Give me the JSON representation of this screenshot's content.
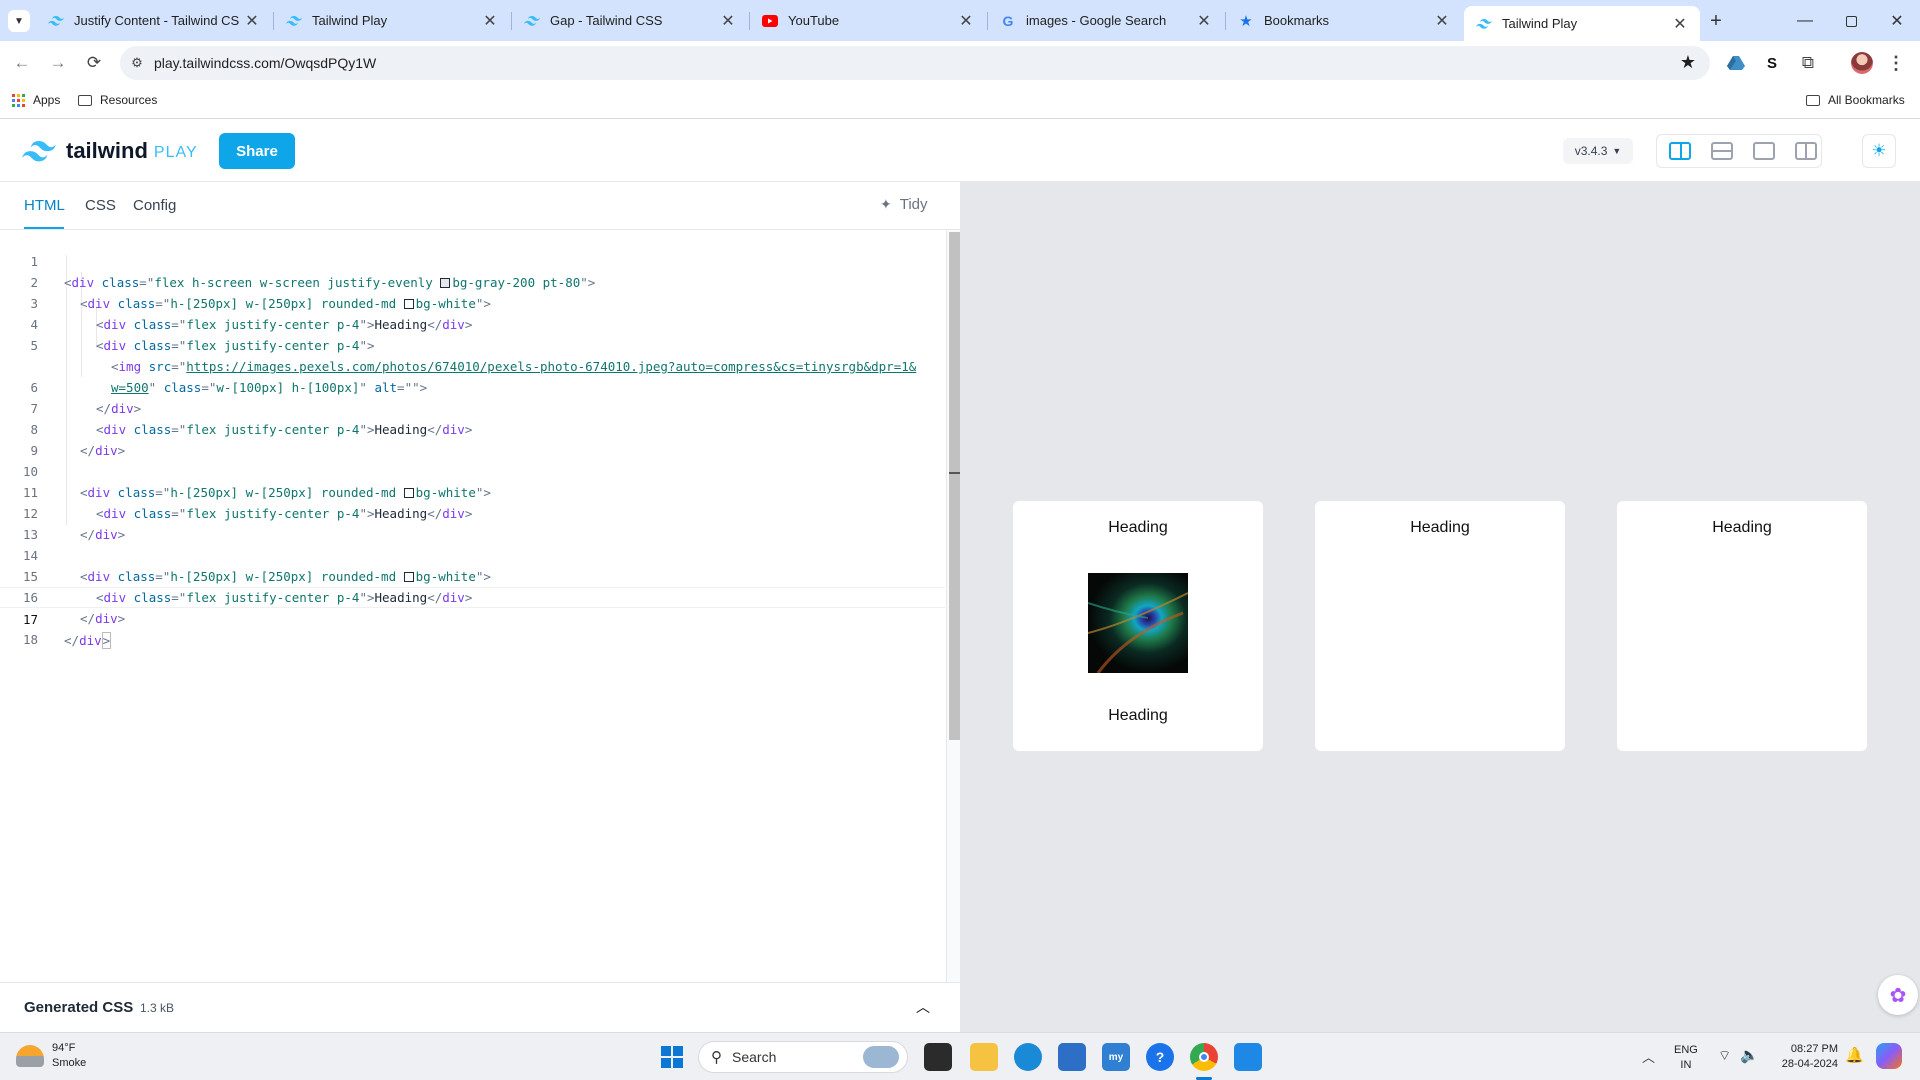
{
  "browser": {
    "tabs": [
      {
        "title": "Justify Content - Tailwind CSS",
        "icon": "tailwind-icon"
      },
      {
        "title": "Tailwind Play",
        "icon": "tailwind-icon"
      },
      {
        "title": "Gap - Tailwind CSS",
        "icon": "tailwind-icon"
      },
      {
        "title": "YouTube",
        "icon": "youtube-icon"
      },
      {
        "title": "images - Google Search",
        "icon": "google-icon"
      },
      {
        "title": "Bookmarks",
        "icon": "star-icon"
      },
      {
        "title": "Tailwind Play",
        "icon": "tailwind-icon",
        "active": true
      }
    ],
    "url": "play.tailwindcss.com/OwqsdPQy1W",
    "bookmarks": {
      "apps": "Apps",
      "resources": "Resources",
      "all": "All Bookmarks"
    }
  },
  "app": {
    "logo_text": "tailwind",
    "logo_play": "PLAY",
    "share": "Share",
    "version": "v3.4.3",
    "accent": "#0ea5e9"
  },
  "editor": {
    "tabs": [
      "HTML",
      "CSS",
      "Config"
    ],
    "active_tab": "HTML",
    "tidy": "Tidy",
    "generated_css": "Generated CSS",
    "generated_size": "1.3 kB",
    "lines": [
      {
        "n": "1"
      },
      {
        "n": "2"
      },
      {
        "n": "3"
      },
      {
        "n": "4"
      },
      {
        "n": "5"
      },
      {
        "n": ""
      },
      {
        "n": "6"
      },
      {
        "n": "7"
      },
      {
        "n": "8"
      },
      {
        "n": "9"
      },
      {
        "n": "10"
      },
      {
        "n": "11"
      },
      {
        "n": "12"
      },
      {
        "n": "13"
      },
      {
        "n": "14"
      },
      {
        "n": "15"
      },
      {
        "n": "16"
      },
      {
        "n": "17"
      },
      {
        "n": "18"
      }
    ],
    "code": {
      "l1_cls": "flex h-screen w-screen justify-evenly ",
      "l1_cls2": "bg-gray-200 pt-80",
      "card_cls": "h-[250px] w-[250px] rounded-md ",
      "card_cls2": "bg-white",
      "inner_cls": "flex justify-center p-4",
      "heading": "Heading",
      "img_src_a": "https://images.pexels.com/photos/674010/pexels-photo-674010.jpeg?auto=compress&cs=tinysrgb&dpr=1&",
      "img_src_b": "w=500",
      "img_cls": "w-[100px] h-[100px]",
      "img_alt": ""
    }
  },
  "preview": {
    "cards": [
      {
        "top_heading": "Heading",
        "has_image": true,
        "bottom_heading": "Heading"
      },
      {
        "top_heading": "Heading"
      },
      {
        "top_heading": "Heading"
      }
    ]
  },
  "taskbar": {
    "weather_temp": "94°F",
    "weather_desc": "Smoke",
    "search": "Search",
    "lang1": "ENG",
    "lang2": "IN",
    "time": "08:27 PM",
    "date": "28-04-2024"
  }
}
